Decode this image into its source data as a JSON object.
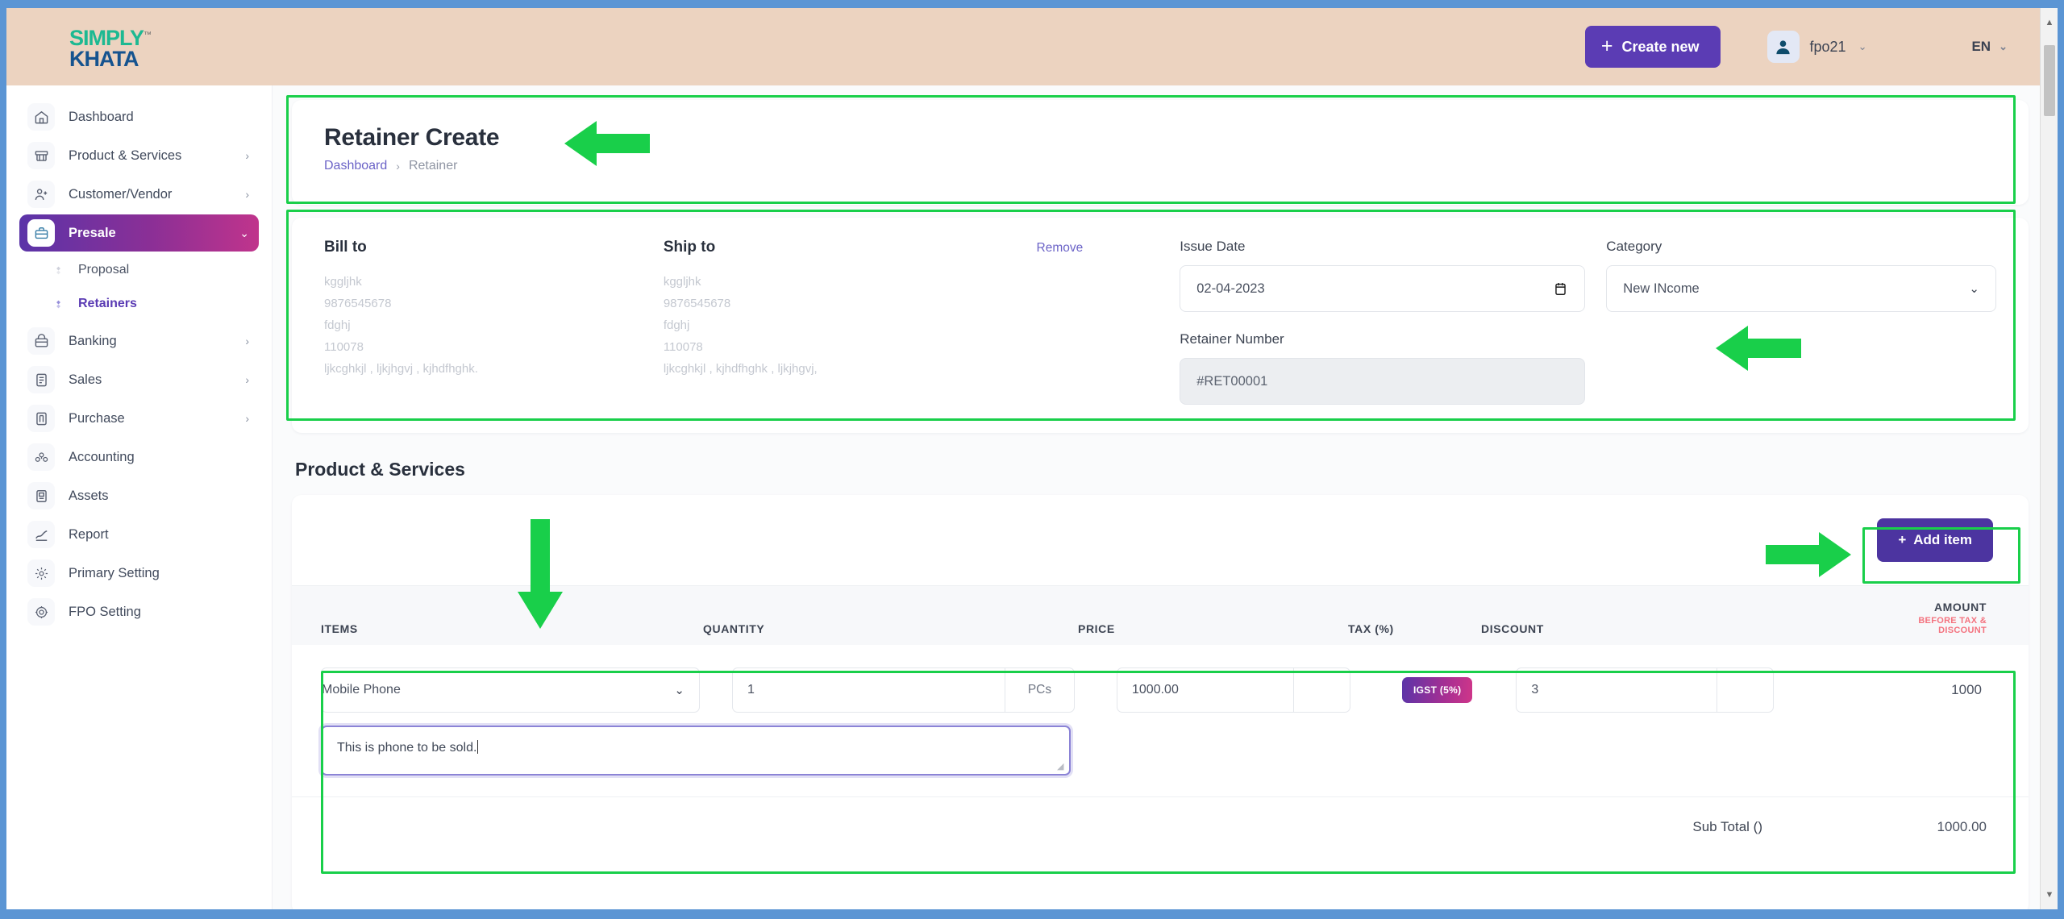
{
  "header": {
    "logo_line1": "SIMPLY",
    "logo_tm": "™",
    "logo_line2": "KHATA",
    "create_new_label": "Create new",
    "create_new_icon": "plus-icon",
    "user_name": "fpo21",
    "user_caret": "⌄",
    "language": "EN",
    "language_caret": "⌄",
    "accent_purple": "#5b3cb4",
    "topbar_bg": "#ecd3c0"
  },
  "sidebar": {
    "items": [
      {
        "label": "Dashboard",
        "icon": "home-icon",
        "chevron": "",
        "active": false
      },
      {
        "label": "Product & Services",
        "icon": "cart-icon",
        "chevron": "›",
        "active": false
      },
      {
        "label": "Customer/Vendor",
        "icon": "user-plus-icon",
        "chevron": "›",
        "active": false
      },
      {
        "label": "Presale",
        "icon": "briefcase-icon",
        "chevron": "⌄",
        "active": true
      },
      {
        "label": "Banking",
        "icon": "bank-icon",
        "chevron": "›",
        "active": false
      },
      {
        "label": "Sales",
        "icon": "doc-icon",
        "chevron": "›",
        "active": false
      },
      {
        "label": "Purchase",
        "icon": "purchase-icon",
        "chevron": "›",
        "active": false
      },
      {
        "label": "Accounting",
        "icon": "accounting-icon",
        "chevron": "",
        "active": false
      },
      {
        "label": "Assets",
        "icon": "assets-icon",
        "chevron": "",
        "active": false
      },
      {
        "label": "Report",
        "icon": "report-icon",
        "chevron": "",
        "active": false
      },
      {
        "label": "Primary Setting",
        "icon": "settings-icon",
        "chevron": "",
        "active": false
      },
      {
        "label": "FPO Setting",
        "icon": "gear-icon",
        "chevron": "",
        "active": false
      }
    ],
    "subitems": [
      {
        "label": "Proposal",
        "current": false
      },
      {
        "label": "Retainers",
        "current": true
      }
    ]
  },
  "page": {
    "title": "Retainer Create",
    "breadcrumb_root": "Dashboard",
    "breadcrumb_sep": "›",
    "breadcrumb_current": "Retainer"
  },
  "info": {
    "bill_to_head": "Bill to",
    "bill_to_lines": [
      "kggljhk",
      "9876545678",
      "fdghj",
      "110078",
      "ljkcghkjl , ljkjhgvj , kjhdfhghk."
    ],
    "ship_to_head": "Ship to",
    "ship_to_lines": [
      "kggljhk",
      "9876545678",
      "fdghj",
      "110078",
      "ljkcghkjl , kjhdfhghk , ljkjhgvj,"
    ],
    "remove_label": "Remove",
    "issue_date_label": "Issue Date",
    "issue_date_value": "02-04-2023",
    "issue_date_icon": "calendar-icon",
    "category_label": "Category",
    "category_value": "New INcome",
    "category_caret": "⌄",
    "retainer_number_label": "Retainer Number",
    "retainer_number_value": "#RET00001"
  },
  "products": {
    "section_title": "Product & Services",
    "add_item_label": "Add item",
    "add_item_icon": "plus-icon",
    "columns": {
      "items": "ITEMS",
      "quantity": "QUANTITY",
      "price": "PRICE",
      "tax": "TAX (%)",
      "discount": "DISCOUNT",
      "amount": "AMOUNT",
      "amount_sub": "BEFORE TAX & DISCOUNT"
    },
    "rows": [
      {
        "item_name": "Mobile Phone",
        "item_caret": "⌄",
        "quantity": "1",
        "quantity_unit": "PCs",
        "price": "1000.00",
        "tax_badge": "IGST (5%)",
        "discount": "3",
        "amount": "1000",
        "description": "This is phone to be sold."
      }
    ],
    "subtotal_label": "Sub Total ()",
    "subtotal_value": "1000.00"
  },
  "annotations": {
    "highlight_color": "#19cf4a",
    "arrow_color": "#19cf4a",
    "count": 4
  }
}
